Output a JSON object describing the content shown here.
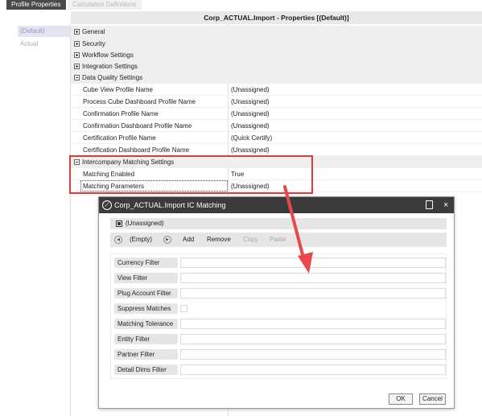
{
  "tabs": {
    "active": "Profile Properties",
    "inactive": "Calculation Definitions"
  },
  "header": {
    "title": "Corp_ACTUAL.Import - Properties  [(Default)]"
  },
  "left_list": {
    "items": [
      "(Default)",
      "Actual"
    ]
  },
  "categories": {
    "general": "General",
    "security": "Security",
    "workflow": "Workflow Settings",
    "integration": "Integration Settings",
    "data_quality": "Data Quality Settings",
    "intercompany": "Intercompany Matching Settings"
  },
  "data_quality_props": [
    {
      "name": "Cube View Profile Name",
      "value": "(Unassigned)"
    },
    {
      "name": "Process Cube Dashboard Profile Name",
      "value": "(Unassigned)"
    },
    {
      "name": "Confirmation Profile Name",
      "value": "(Unassigned)"
    },
    {
      "name": "Confirmation Dashboard Profile Name",
      "value": "(Unassigned)"
    },
    {
      "name": "Certification Profile Name",
      "value": "(Quick Certify)"
    },
    {
      "name": "Certification Dashboard Profile Name",
      "value": "(Unassigned)"
    }
  ],
  "intercompany_props": [
    {
      "name": "Matching Enabled",
      "value": "True"
    },
    {
      "name": "Matching Parameters",
      "value": "(Unassigned)"
    }
  ],
  "dialog": {
    "title": "Corp_ACTUAL.Import  IC Matching",
    "logo_glyph": "∕",
    "close_glyph": "×",
    "unassigned_label": "(Unassigned)",
    "toolbar": {
      "prev_glyph": "◀",
      "empty_label": "(Empty)",
      "next_glyph": "▶",
      "add": "Add",
      "remove": "Remove",
      "copy": "Copy",
      "paste": "Paste"
    },
    "fields": [
      {
        "label": "Currency Filter",
        "type": "text",
        "value": ""
      },
      {
        "label": "View Filter",
        "type": "text",
        "value": ""
      },
      {
        "label": "Plug Account Filter",
        "type": "text",
        "value": ""
      },
      {
        "label": "Suppress Matches",
        "type": "checkbox",
        "checked": false
      },
      {
        "label": "Matching Tolerance",
        "type": "text",
        "value": ""
      },
      {
        "label": "Entity Filter",
        "type": "text",
        "value": ""
      },
      {
        "label": "Partner Filter",
        "type": "text",
        "value": ""
      },
      {
        "label": "Detail Dims Filter",
        "type": "text",
        "value": ""
      }
    ],
    "ok": "OK",
    "cancel": "Cancel"
  },
  "colors": {
    "highlight": "#e03b3b",
    "arrow": "#e8484c",
    "dialog_header": "#3b3b3b"
  }
}
